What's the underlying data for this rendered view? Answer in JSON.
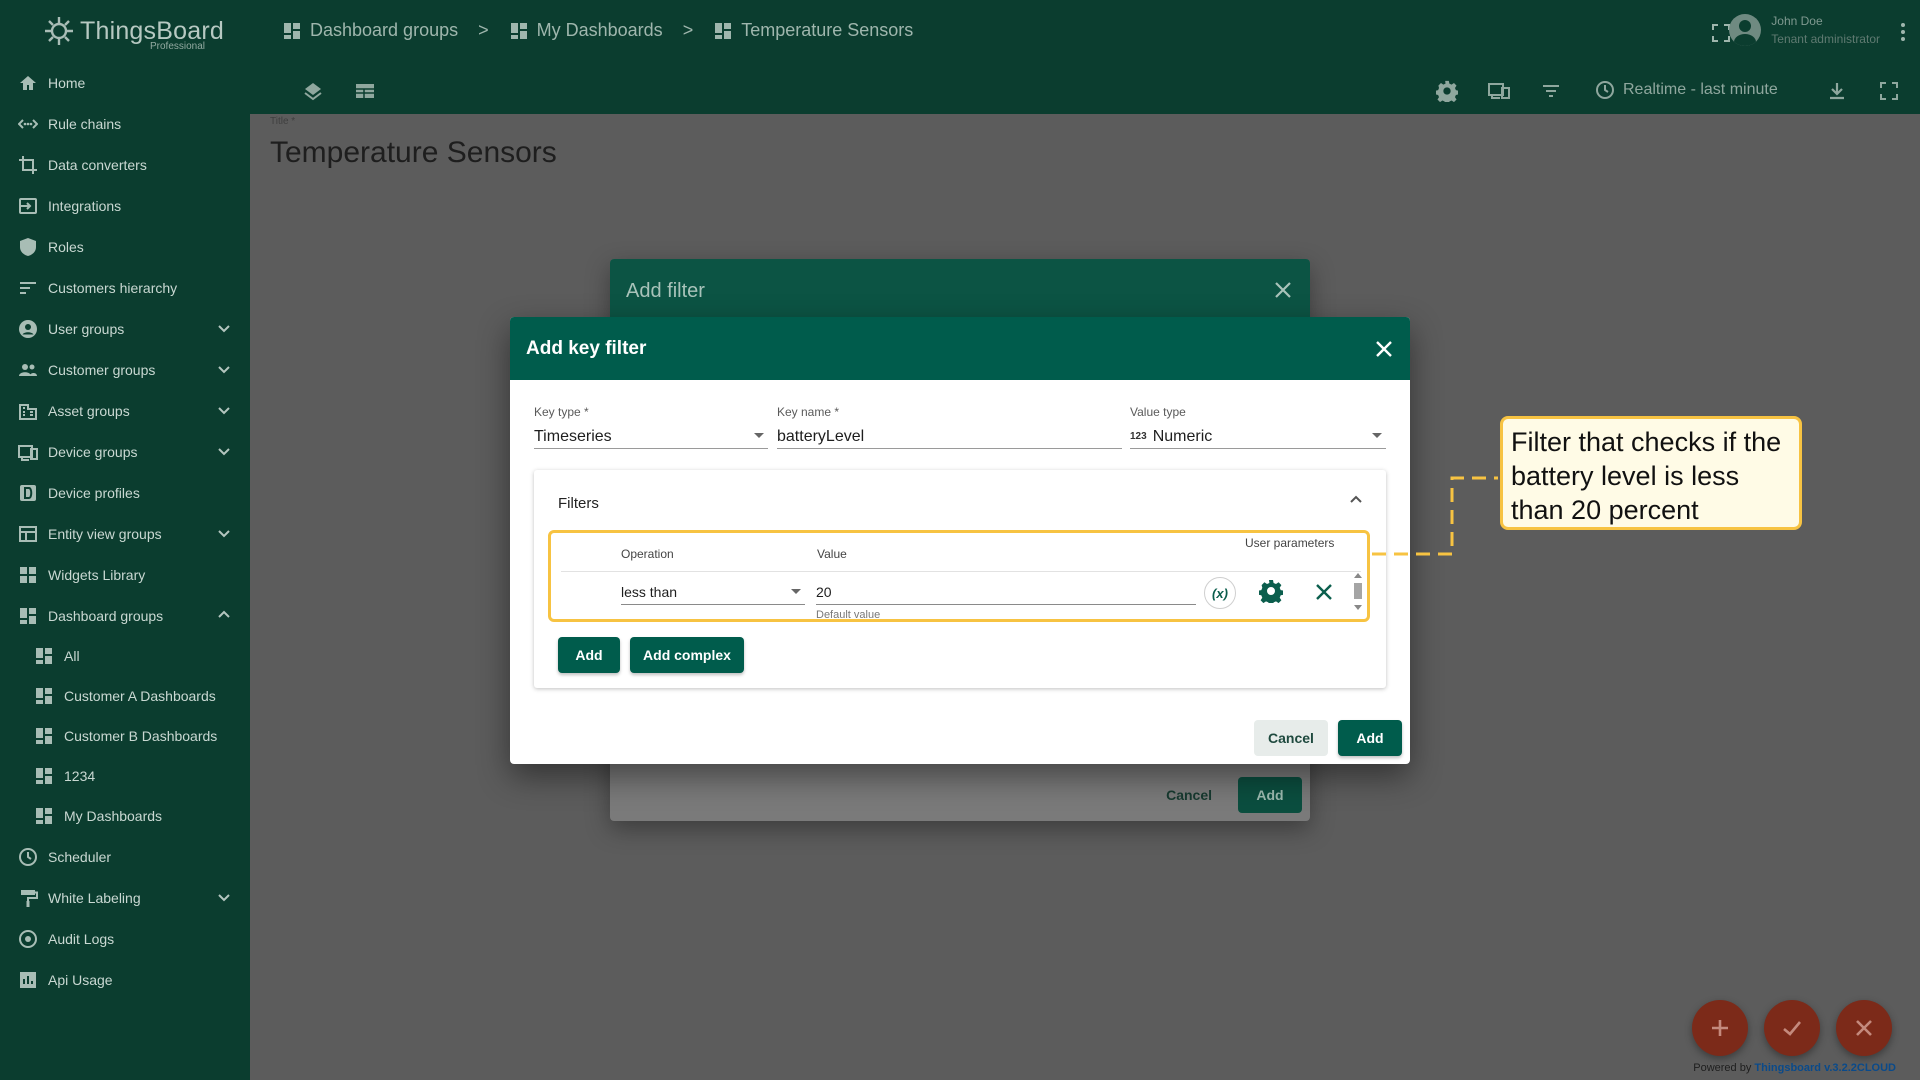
{
  "app": {
    "logo_text": "ThingsBoard",
    "logo_sub": "Professional"
  },
  "sidebar": {
    "items": [
      {
        "label": "Home",
        "icon": "home-icon"
      },
      {
        "label": "Rule chains",
        "icon": "rule-chains-icon"
      },
      {
        "label": "Data converters",
        "icon": "data-converters-icon"
      },
      {
        "label": "Integrations",
        "icon": "integrations-icon"
      },
      {
        "label": "Roles",
        "icon": "shield-icon"
      },
      {
        "label": "Customers hierarchy",
        "icon": "hierarchy-icon"
      },
      {
        "label": "User groups",
        "icon": "user-icon",
        "expandable": true
      },
      {
        "label": "Customer groups",
        "icon": "customers-icon",
        "expandable": true
      },
      {
        "label": "Asset groups",
        "icon": "asset-icon",
        "expandable": true
      },
      {
        "label": "Device groups",
        "icon": "device-icon",
        "expandable": true
      },
      {
        "label": "Device profiles",
        "icon": "device-profile-icon"
      },
      {
        "label": "Entity view groups",
        "icon": "entity-view-icon",
        "expandable": true
      },
      {
        "label": "Widgets Library",
        "icon": "widgets-icon"
      },
      {
        "label": "Dashboard groups",
        "icon": "dashboard-icon",
        "expanded": true
      }
    ],
    "sub_items": [
      "All",
      "Customer A Dashboards",
      "Customer B Dashboards",
      "1234",
      "My Dashboards"
    ],
    "items_after": [
      {
        "label": "Scheduler",
        "icon": "clock-icon"
      },
      {
        "label": "White Labeling",
        "icon": "paint-roller-icon",
        "expandable": true
      },
      {
        "label": "Audit Logs",
        "icon": "audit-icon"
      },
      {
        "label": "Api Usage",
        "icon": "chart-icon"
      }
    ]
  },
  "header": {
    "breadcrumbs": [
      "Dashboard groups",
      "My Dashboards",
      "Temperature Sensors"
    ],
    "separator": ">",
    "user_name": "John Doe",
    "user_role": "Tenant administrator",
    "realtime": "Realtime - last minute"
  },
  "page": {
    "title_label": "Title *",
    "title": "Temperature Sensors"
  },
  "back_dialog": {
    "title": "Add filter",
    "cancel": "Cancel",
    "add": "Add"
  },
  "dialog": {
    "title": "Add key filter",
    "key_type_label": "Key type *",
    "key_type_value": "Timeseries",
    "key_name_label": "Key name *",
    "key_name_value": "batteryLevel",
    "value_type_label": "Value type",
    "value_type_badge": "123",
    "value_type_value": "Numeric",
    "filters_title": "Filters",
    "col_operation": "Operation",
    "col_value": "Value",
    "col_user_params": "User parameters",
    "operation_value": "less than",
    "value": "20",
    "value_hint": "Default value",
    "fx_label": "(x)",
    "add_btn": "Add",
    "add_complex_btn": "Add complex",
    "cancel": "Cancel",
    "submit": "Add"
  },
  "callout": {
    "text": "Filter that checks if the battery level is less than 20 percent"
  },
  "footer": {
    "powered_prefix": "Powered by ",
    "powered_link": "Thingsboard v.3.2.2CLOUD"
  },
  "colors": {
    "accent": "#005c4c",
    "highlight": "#f7c342",
    "sidebar_bg": "#0b3d2f"
  }
}
